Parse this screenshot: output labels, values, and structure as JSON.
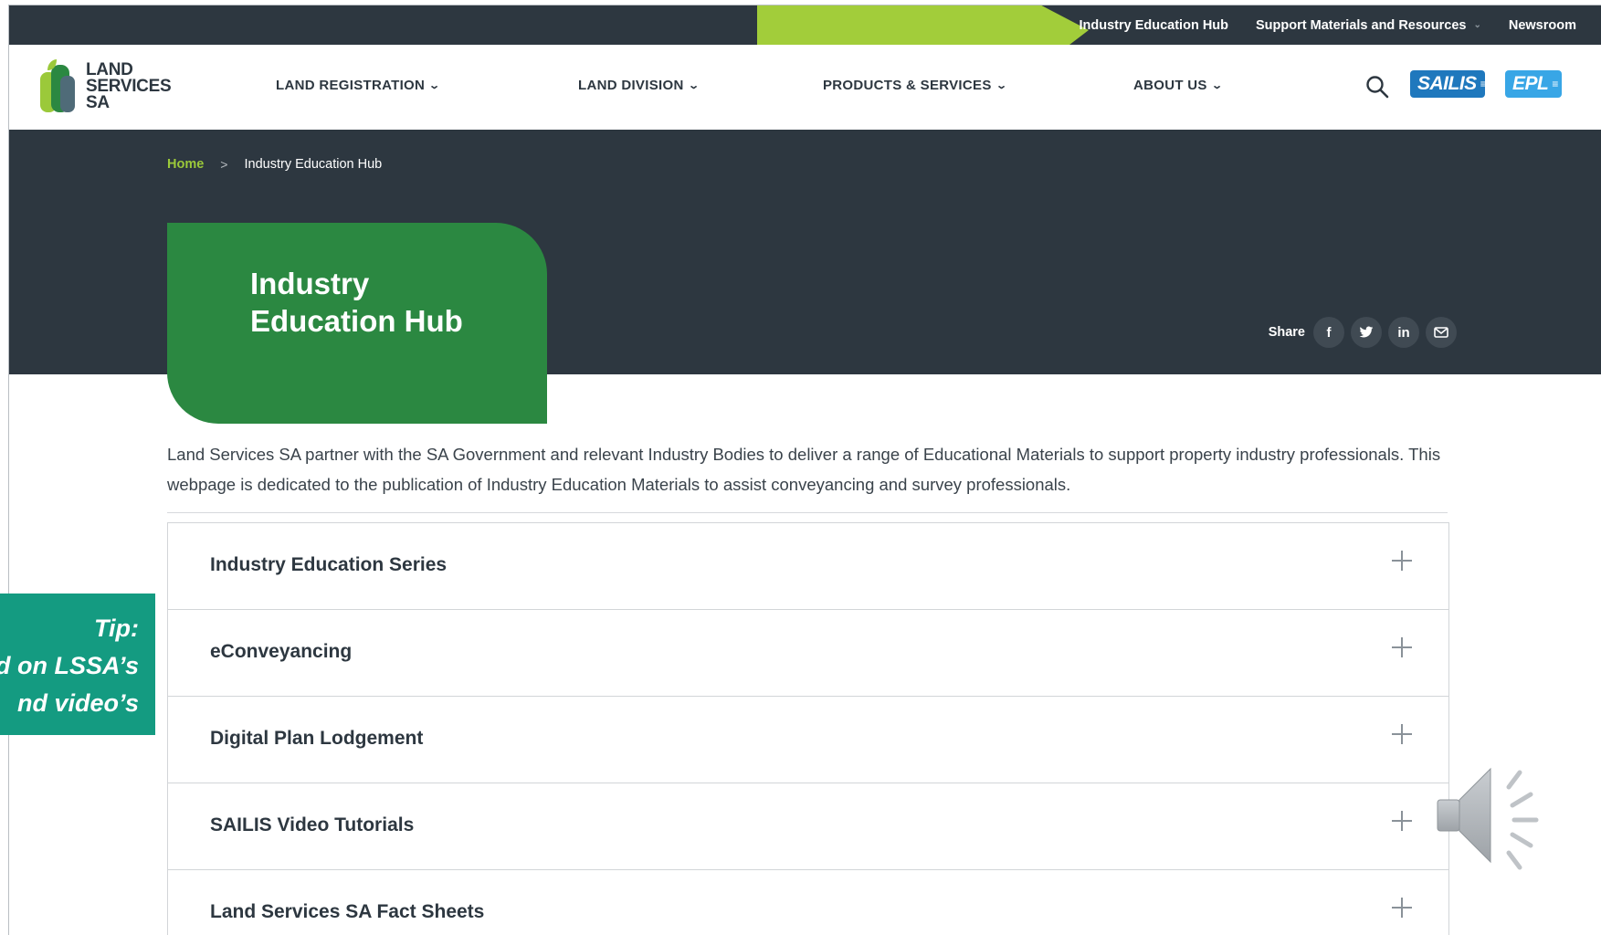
{
  "utility_nav": {
    "links": [
      {
        "label": "Industry Education Hub",
        "has_dropdown": false
      },
      {
        "label": "Support Materials and Resources",
        "has_dropdown": true
      },
      {
        "label": "Newsroom",
        "has_dropdown": false
      }
    ]
  },
  "logo": {
    "line1": "LAND",
    "line2": "SERVICES",
    "line3": "SA"
  },
  "main_nav": {
    "items": [
      {
        "label": "LAND REGISTRATION"
      },
      {
        "label": "LAND DIVISION"
      },
      {
        "label": "PRODUCTS & SERVICES"
      },
      {
        "label": "ABOUT US"
      }
    ],
    "badges": {
      "sailis": "SAILIS",
      "epl": "EPL"
    }
  },
  "breadcrumb": {
    "home": "Home",
    "separator": ">",
    "current": "Industry Education Hub"
  },
  "hero": {
    "title": "Industry Education Hub"
  },
  "share": {
    "label": "Share",
    "icons": [
      "facebook-icon",
      "twitter-icon",
      "linkedin-icon",
      "email-icon"
    ]
  },
  "intro": "Land Services SA partner with the SA Government and relevant Industry Bodies to deliver a range of Educational Materials to support property industry professionals. This webpage is dedicated to the publication of Industry Education Materials to assist conveyancing and survey professionals.",
  "accordion": [
    {
      "label": "Industry Education Series"
    },
    {
      "label": "eConveyancing"
    },
    {
      "label": "Digital Plan Lodgement"
    },
    {
      "label": "SAILIS Video Tutorials"
    },
    {
      "label": "Land Services SA Fact Sheets"
    }
  ],
  "tip": {
    "line1": "Tip:",
    "line2": "d on LSSA’s",
    "line3": "nd video’s"
  },
  "colors": {
    "dark": "#2d3740",
    "brand_green": "#2b8841",
    "lime": "#9bc93a",
    "teal": "#149b81",
    "sailis_blue": "#1f78bd"
  }
}
